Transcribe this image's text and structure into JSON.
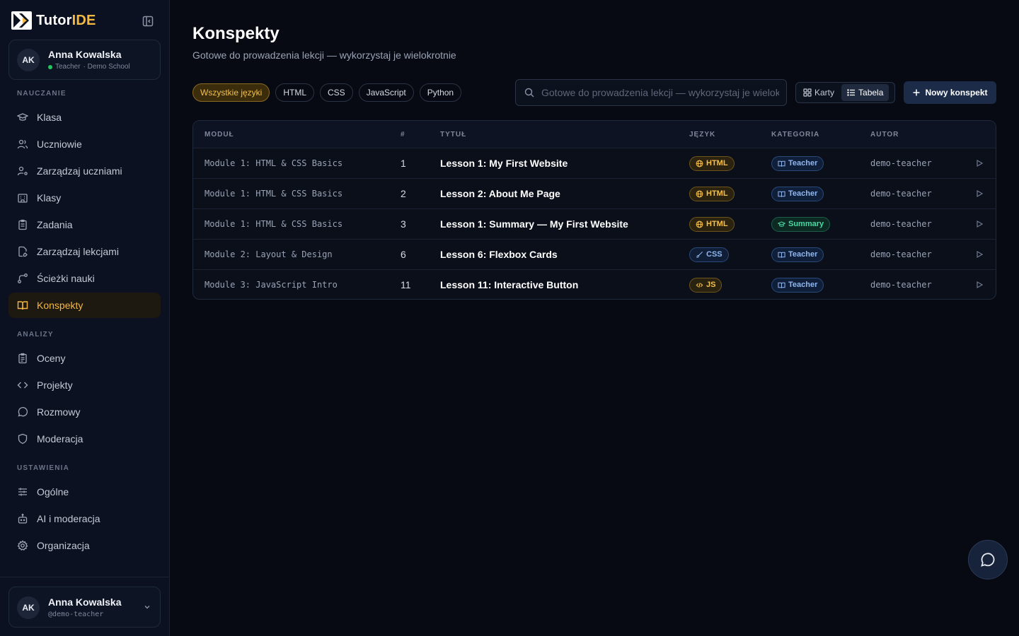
{
  "brand": {
    "name_prefix": "Tutor",
    "name_suffix": "IDE"
  },
  "user": {
    "initials": "AK",
    "name": "Anna Kowalska",
    "role": "Teacher",
    "school": "· Demo School",
    "handle": "@demo-teacher"
  },
  "sidebar": {
    "sections": [
      {
        "label": "NAUCZANIE",
        "items": [
          {
            "label": "Klasa",
            "icon": "graduation-cap-icon"
          },
          {
            "label": "Uczniowie",
            "icon": "users-icon"
          },
          {
            "label": "Zarządzaj uczniami",
            "icon": "user-cog-icon"
          },
          {
            "label": "Klasy",
            "icon": "building-icon"
          },
          {
            "label": "Zadania",
            "icon": "clipboard-icon"
          },
          {
            "label": "Zarządzaj lekcjami",
            "icon": "file-edit-icon"
          },
          {
            "label": "Ścieżki nauki",
            "icon": "route-icon"
          },
          {
            "label": "Konspekty",
            "icon": "book-open-icon",
            "active": true
          }
        ]
      },
      {
        "label": "ANALIZY",
        "items": [
          {
            "label": "Oceny",
            "icon": "clipboard-check-icon"
          },
          {
            "label": "Projekty",
            "icon": "code-icon"
          },
          {
            "label": "Rozmowy",
            "icon": "message-circle-icon"
          },
          {
            "label": "Moderacja",
            "icon": "shield-icon"
          }
        ]
      },
      {
        "label": "USTAWIENIA",
        "items": [
          {
            "label": "Ogólne",
            "icon": "sliders-icon"
          },
          {
            "label": "AI i moderacja",
            "icon": "bot-icon"
          },
          {
            "label": "Organizacja",
            "icon": "gear-icon"
          }
        ]
      }
    ]
  },
  "page": {
    "title": "Konspekty",
    "subtitle": "Gotowe do prowadzenia lekcji — wykorzystaj je wielokrotnie",
    "filters": [
      "Wszystkie języki",
      "HTML",
      "CSS",
      "JavaScript",
      "Python"
    ],
    "active_filter": "Wszystkie języki",
    "search_placeholder": "Gotowe do prowadzenia lekcji — wykorzystaj je wielokrotnie",
    "view": {
      "cards": "Karty",
      "table": "Tabela",
      "active": "Tabela"
    },
    "new_button": "Nowy konspekt"
  },
  "table": {
    "headers": [
      "MODUŁ",
      "#",
      "TYTUŁ",
      "JĘZYK",
      "KATEGORIA",
      "AUTOR"
    ],
    "rows": [
      {
        "module": "Module 1: HTML & CSS Basics",
        "num": "1",
        "title": "Lesson 1: My First Website",
        "lang": "HTML",
        "category": "Teacher",
        "author": "demo-teacher"
      },
      {
        "module": "Module 1: HTML & CSS Basics",
        "num": "2",
        "title": "Lesson 2: About Me Page",
        "lang": "HTML",
        "category": "Teacher",
        "author": "demo-teacher"
      },
      {
        "module": "Module 1: HTML & CSS Basics",
        "num": "3",
        "title": "Lesson 1: Summary — My First Website",
        "lang": "HTML",
        "category": "Summary",
        "author": "demo-teacher"
      },
      {
        "module": "Module 2: Layout & Design",
        "num": "6",
        "title": "Lesson 6: Flexbox Cards",
        "lang": "CSS",
        "category": "Teacher",
        "author": "demo-teacher"
      },
      {
        "module": "Module 3: JavaScript Intro",
        "num": "11",
        "title": "Lesson 11: Interactive Button",
        "lang": "JS",
        "category": "Teacher",
        "author": "demo-teacher"
      }
    ]
  },
  "colors": {
    "accent": "#f5b841",
    "background": "#070a12",
    "sidebar": "#0b1120"
  }
}
